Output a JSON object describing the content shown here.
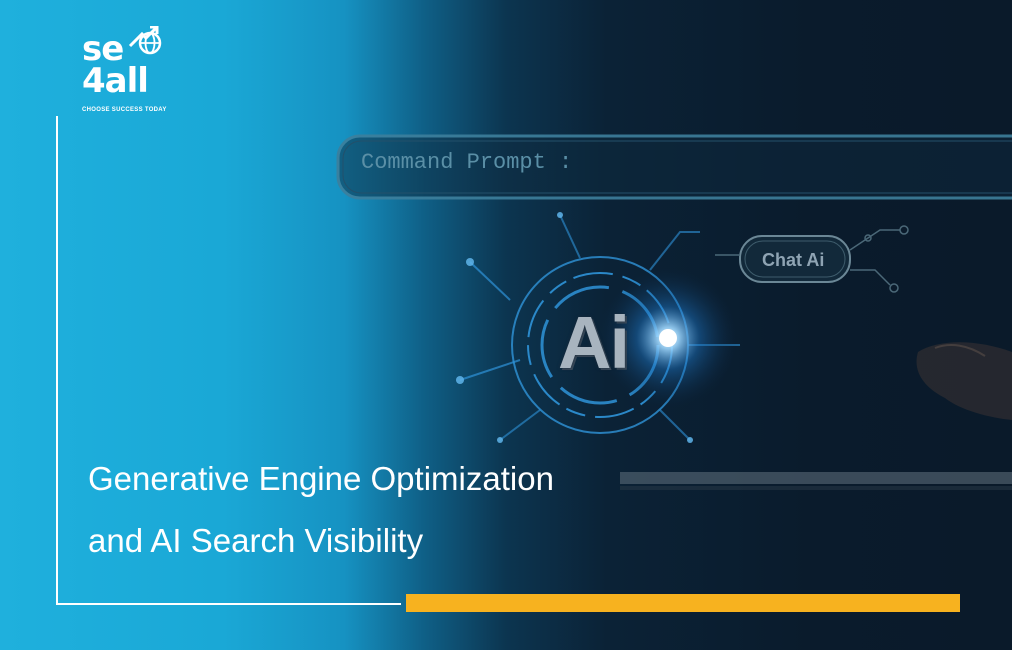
{
  "logo": {
    "line1": "se",
    "line2": "4all",
    "tagline": "CHOOSE SUCCESS TODAY",
    "icon": "globe-arrow-icon"
  },
  "graphic": {
    "command_prompt": "Command Prompt :",
    "chat_label": "Chat Ai",
    "ai_label": "Ai"
  },
  "headline": {
    "line1": "Generative Engine Optimization",
    "line2": "and AI Search Visibility"
  },
  "colors": {
    "background_left": "#1fb0dd",
    "background_right": "#0a1a2a",
    "accent": "#f7b21f",
    "text": "#ffffff"
  }
}
